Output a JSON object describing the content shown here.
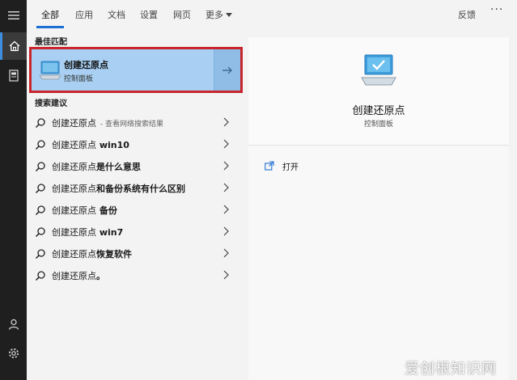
{
  "tabs": [
    {
      "label": "全部",
      "active": true
    },
    {
      "label": "应用"
    },
    {
      "label": "文档"
    },
    {
      "label": "设置"
    },
    {
      "label": "网页"
    },
    {
      "label": "更多"
    }
  ],
  "header": {
    "feedback": "反馈",
    "more_options": "···"
  },
  "best_match": {
    "section_label": "最佳匹配",
    "title": "创建还原点",
    "subtitle": "控制面板"
  },
  "suggestions": {
    "section_label": "搜索建议",
    "items": [
      {
        "prefix": "创建还原点",
        "suffix": "",
        "extra": " - 查看网络搜索结果"
      },
      {
        "prefix": "创建还原点",
        "suffix": " win10",
        "extra": ""
      },
      {
        "prefix": "创建还原点",
        "suffix": "是什么意思",
        "extra": ""
      },
      {
        "prefix": "创建还原点",
        "suffix": "和备份系统有什么区别",
        "extra": ""
      },
      {
        "prefix": "创建还原点",
        "suffix": " 备份",
        "extra": ""
      },
      {
        "prefix": "创建还原点",
        "suffix": " win7",
        "extra": ""
      },
      {
        "prefix": "创建还原点",
        "suffix": "恢复软件",
        "extra": ""
      },
      {
        "prefix": "创建还原点",
        "suffix": "。",
        "extra": ""
      }
    ]
  },
  "detail": {
    "title": "创建还原点",
    "subtitle": "控制面板",
    "actions": [
      {
        "label": "打开",
        "icon": "open-icon"
      }
    ]
  },
  "watermark": "爱创根知识网",
  "colors": {
    "accent": "#1e6fd2",
    "selection": "#a9d0f3",
    "highlight_border": "#c8252c",
    "rail": "#1f1f1f"
  }
}
